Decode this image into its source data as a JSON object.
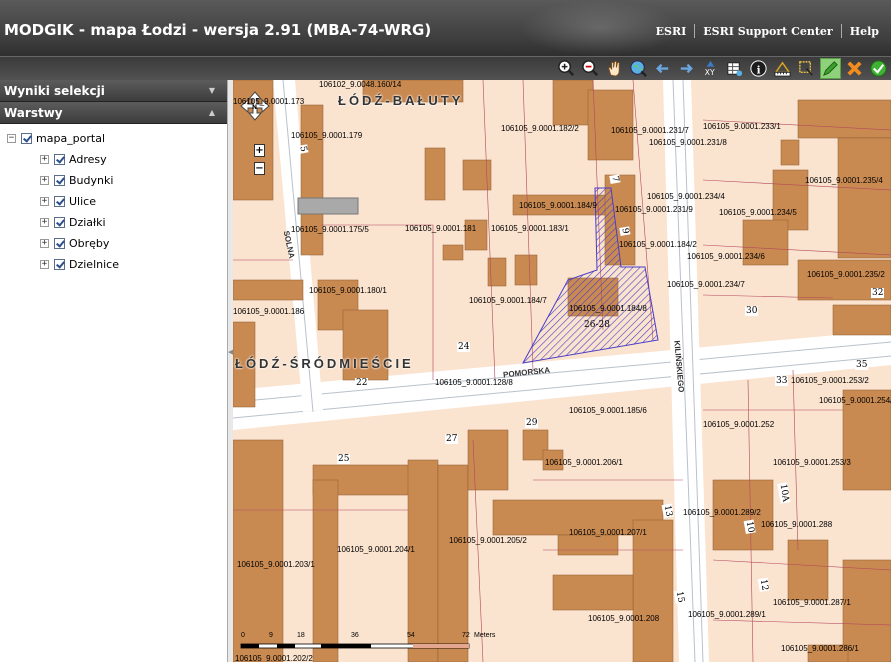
{
  "header": {
    "title": "MODGIK - mapa Łodzi - wersja 2.91 (MBA-74-WRG)",
    "links": [
      "ESRI",
      "ESRI Support Center",
      "Help"
    ]
  },
  "toolbar": {
    "tools": [
      "zoom-in-icon",
      "zoom-out-icon",
      "pan-hand-icon",
      "full-extent-icon",
      "back-arrow-icon",
      "forward-arrow-icon",
      "xy-coordinate-icon",
      "table-icon",
      "info-icon",
      "measure-icon",
      "select-icon",
      "edit-pencil-icon",
      "clear-selection-icon",
      "confirm-icon"
    ]
  },
  "panels": {
    "selection_title": "Wyniki selekcji",
    "layers_title": "Warstwy"
  },
  "layers": {
    "root": "mapa_portal",
    "items": [
      "Adresy",
      "Budynki",
      "Ulice",
      "Działki",
      "Obręby",
      "Dzielnice"
    ]
  },
  "map": {
    "districts": [
      "ŁÓDŹ-BAŁUTY",
      "ŁÓDŹ-ŚRÓDMIEŚCIE"
    ],
    "streets": [
      "SOLNA",
      "POMORSKA",
      "KILIŃSKIEGO"
    ],
    "parcels": [
      "106102_9.0048.160/14",
      "106105_9.0001.173",
      "106105_9.0001.179",
      "106105_9.0001.182/2",
      "106105_9.0001.231/7",
      "106105_9.0001.231/8",
      "106105_9.0001.233/1",
      "106105_9.0001.184/9",
      "106105_9.0001.234/4",
      "106105_9.0001.231/9",
      "106105_9.0001.234/5",
      "106105_9.0001.235/4",
      "106105_9.0001.175/5",
      "106105_9.0001.181",
      "106105_9.0001.183/1",
      "106105_9.0001.184/2",
      "106105_9.0001.234/6",
      "106105_9.0001.180/1",
      "106105_9.0001.234/7",
      "106105_9.0001.235/2",
      "106105_9.0001.184/7",
      "106105_9.0001.184/8",
      "106105_9.0001.186",
      "106105_9.0001.128/8",
      "106105_9.0001.253/2",
      "106105_9.0001.254/1",
      "106105_9.0001.185/6",
      "106105_9.0001.252",
      "106105_9.0001.206/1",
      "106105_9.0001.253/3",
      "106105_9.0001.289/2",
      "106105_9.0001.288",
      "106105_9.0001.204/1",
      "106105_9.0001.205/2",
      "106105_9.0001.207/1",
      "106105_9.0001.203/1",
      "106105_9.0001.287/1",
      "106105_9.0001.208",
      "106105_9.0001.289/1",
      "106105_9.0001.286/1",
      "106105_9.0001.202/2"
    ],
    "house_numbers": [
      "5",
      "7",
      "9",
      "22",
      "24",
      "26-28",
      "30",
      "32",
      "33",
      "35",
      "25",
      "27",
      "29",
      "13",
      "15",
      "10",
      "10A",
      "12"
    ],
    "scale": {
      "labels": [
        "0",
        "9",
        "18",
        "36",
        "54",
        "72"
      ],
      "unit": "Meters"
    },
    "pan_label": "N",
    "zoom_in": "+",
    "zoom_out": "−"
  }
}
